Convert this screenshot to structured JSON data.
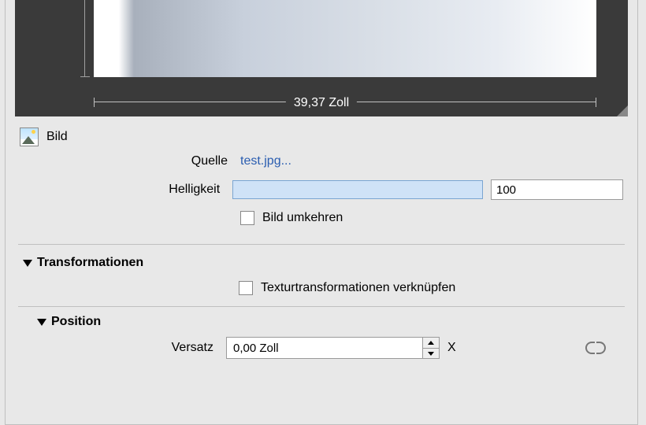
{
  "preview": {
    "width_label": "39,37 Zoll"
  },
  "bild": {
    "title": "Bild",
    "source_label": "Quelle",
    "source_link": "test.jpg...",
    "brightness_label": "Helligkeit",
    "brightness_value": "100",
    "invert_label": "Bild umkehren"
  },
  "transform": {
    "title": "Transformationen",
    "link_textures_label": "Texturtransformationen verknüpfen"
  },
  "position": {
    "title": "Position",
    "offset_label": "Versatz",
    "offset_x_value": "0,00 Zoll",
    "axis_x": "X"
  }
}
